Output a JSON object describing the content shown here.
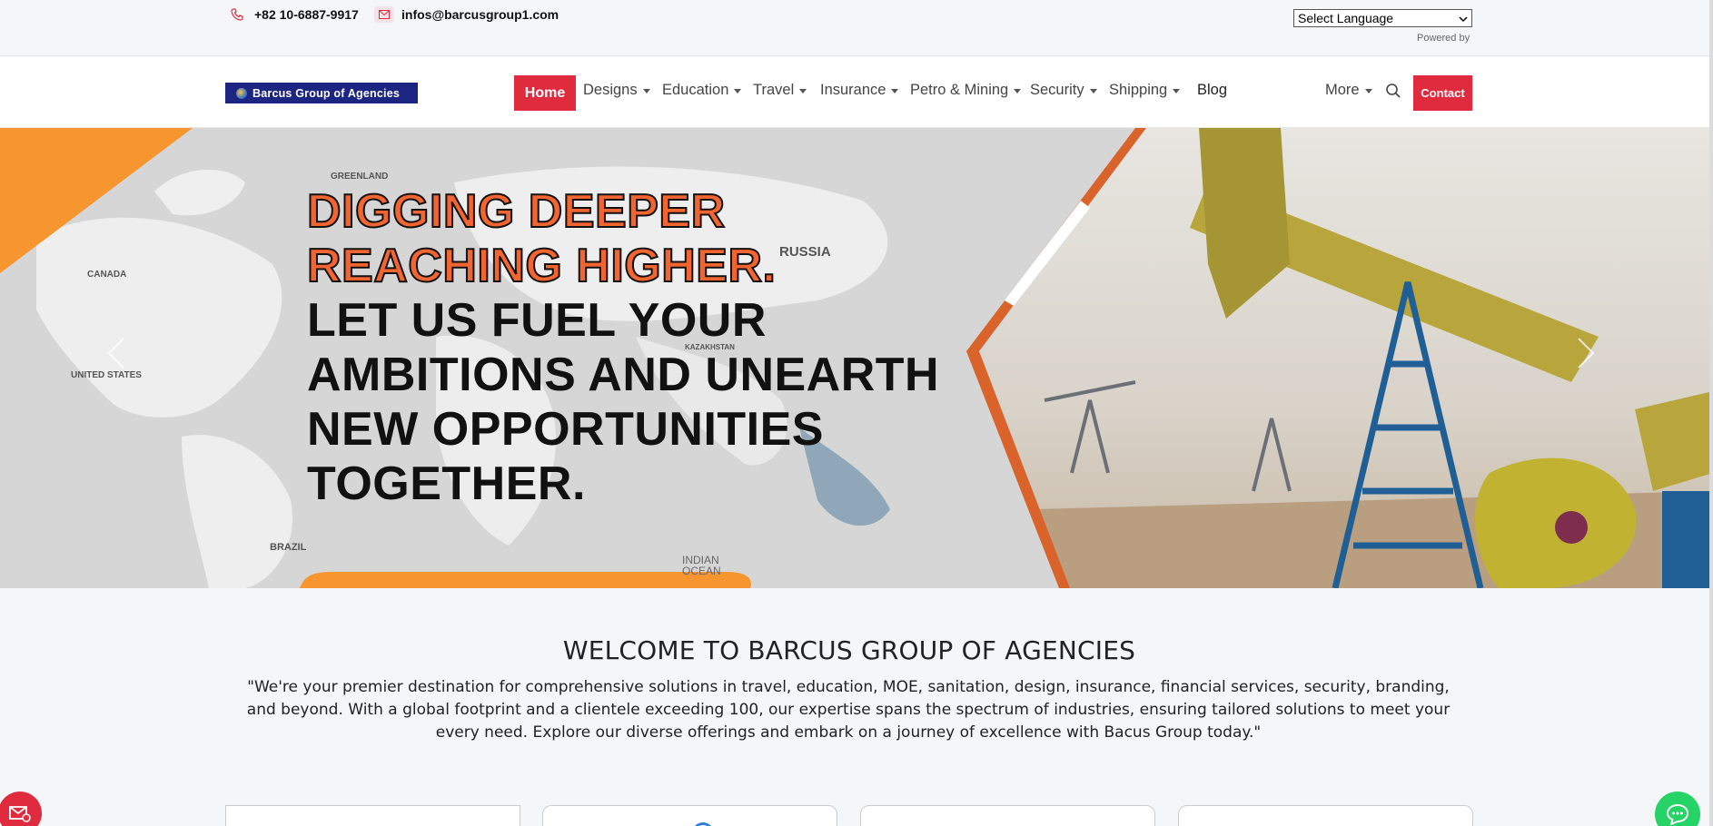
{
  "topbar": {
    "phone": "+82 10-6887-9917",
    "email": "infos@barcusgroup1.com",
    "language_select": "Select Language",
    "powered_by": "Powered by"
  },
  "navbar": {
    "logo_text": "Barcus Group of Agencies",
    "items": [
      {
        "label": "Home",
        "active": true,
        "dropdown": false
      },
      {
        "label": "Designs",
        "dropdown": true
      },
      {
        "label": "Education",
        "dropdown": true
      },
      {
        "label": "Travel",
        "dropdown": true
      },
      {
        "label": "Insurance",
        "dropdown": true
      },
      {
        "label": "Petro & Mining",
        "dropdown": true
      },
      {
        "label": "Security",
        "dropdown": true
      },
      {
        "label": "Shipping",
        "dropdown": true
      },
      {
        "label": "Blog",
        "dropdown": false
      },
      {
        "label": "More",
        "dropdown": true
      }
    ],
    "contact_button": "Contact",
    "icons": {
      "search": "search-icon"
    }
  },
  "hero": {
    "line1": "DIGGING DEEPER",
    "line2": "REACHING HIGHER.",
    "line3": "LET US FUEL YOUR",
    "line4": "AMBITIONS AND UNEARTH",
    "line5": "NEW OPPORTUNITIES",
    "line6": "TOGETHER.",
    "prev_icon": "chevron-left-icon",
    "next_icon": "chevron-right-icon",
    "map_labels": {
      "greenland": "GREENLAND",
      "canada": "CANADA",
      "united_states": "UNITED STATES",
      "russia": "RUSSIA",
      "kazakhstan": "KAZAKHSTAN",
      "brazil": "BRAZIL",
      "indian_ocean": "INDIAN OCEAN"
    }
  },
  "welcome": {
    "title": "WELCOME TO BARCUS GROUP OF AGENCIES",
    "text": "\"We're your premier destination for comprehensive solutions in travel, education, MOE, sanitation, design, insurance, financial services, security, branding, and beyond. With a global footprint and a clientele exceeding 100, our expertise spans the spectrum of industries, ensuring tailored solutions to meet your every need. Explore our diverse offerings and embark on a journey of excellence with Bacus Group today.\""
  },
  "floating": {
    "mail_icon": "mail-icon",
    "chat_icon": "chat-icon"
  },
  "colors": {
    "accent_red": "#e02a3e",
    "hero_orange": "#f26531",
    "logo_navy": "#1d2583",
    "chat_green": "#25d366"
  }
}
